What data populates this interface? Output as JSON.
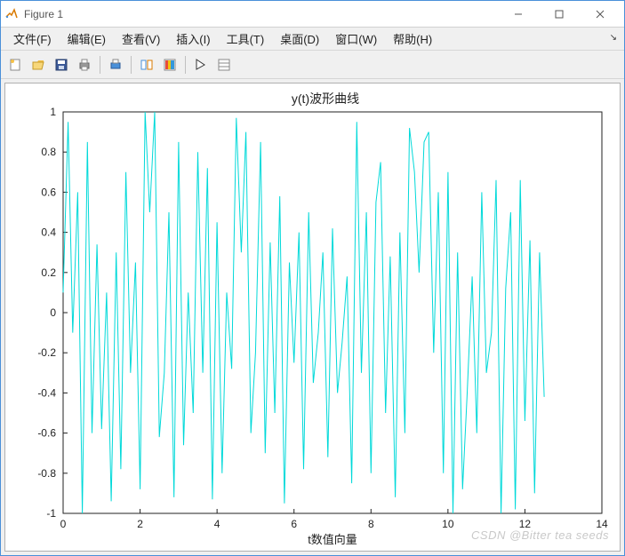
{
  "window": {
    "title": "Figure 1"
  },
  "menu": {
    "file": "文件(F)",
    "edit": "编辑(E)",
    "view": "查看(V)",
    "insert": "插入(I)",
    "tools": "工具(T)",
    "desktop": "桌面(D)",
    "window": "窗口(W)",
    "help": "帮助(H)"
  },
  "toolbar_icons": {
    "new": "new-figure-icon",
    "open": "open-icon",
    "save": "save-icon",
    "print": "print-icon",
    "print_preview": "print-preview-icon",
    "link": "link-icon",
    "colorbar": "colorbar-icon",
    "pointer": "pointer-icon",
    "datacursor": "data-cursor-icon"
  },
  "watermark": "CSDN @Bitter tea seeds",
  "chart_data": {
    "type": "line",
    "title": "y(t)波形曲线",
    "xlabel": "t数值向量",
    "ylabel": "",
    "xlim": [
      0,
      14
    ],
    "ylim": [
      -1,
      1
    ],
    "x_ticks": [
      0,
      2,
      4,
      6,
      8,
      10,
      12,
      14
    ],
    "y_ticks": [
      -1,
      -0.8,
      -0.6,
      -0.4,
      -0.2,
      0,
      0.2,
      0.4,
      0.6,
      0.8,
      1
    ],
    "line_color": "#00d9d9",
    "x": [
      0.0,
      0.13,
      0.25,
      0.38,
      0.5,
      0.63,
      0.75,
      0.88,
      1.0,
      1.13,
      1.25,
      1.38,
      1.5,
      1.63,
      1.75,
      1.88,
      2.0,
      2.13,
      2.25,
      2.38,
      2.5,
      2.63,
      2.75,
      2.88,
      3.0,
      3.13,
      3.25,
      3.38,
      3.5,
      3.63,
      3.75,
      3.88,
      4.0,
      4.13,
      4.25,
      4.38,
      4.5,
      4.63,
      4.75,
      4.88,
      5.0,
      5.13,
      5.25,
      5.38,
      5.5,
      5.63,
      5.75,
      5.88,
      6.0,
      6.13,
      6.25,
      6.38,
      6.5,
      6.63,
      6.75,
      6.88,
      7.0,
      7.13,
      7.25,
      7.38,
      7.5,
      7.63,
      7.75,
      7.88,
      8.0,
      8.13,
      8.25,
      8.38,
      8.5,
      8.63,
      8.75,
      8.88,
      9.0,
      9.13,
      9.25,
      9.38,
      9.5,
      9.63,
      9.75,
      9.88,
      10.0,
      10.13,
      10.25,
      10.38,
      10.5,
      10.63,
      10.75,
      10.88,
      11.0,
      11.13,
      11.25,
      11.38,
      11.5,
      11.63,
      11.75,
      11.88,
      12.0,
      12.13,
      12.25,
      12.38,
      12.5
    ],
    "y": [
      0.1,
      0.95,
      -0.1,
      0.6,
      -1.0,
      0.85,
      -0.6,
      0.34,
      -0.58,
      0.1,
      -0.94,
      0.3,
      -0.78,
      0.7,
      -0.3,
      0.25,
      -0.88,
      1.0,
      0.5,
      1.0,
      -0.62,
      -0.3,
      0.5,
      -0.92,
      0.85,
      -0.66,
      0.1,
      -0.5,
      0.8,
      -0.3,
      0.72,
      -0.93,
      0.45,
      -0.8,
      0.1,
      -0.28,
      0.97,
      0.3,
      0.9,
      -0.6,
      -0.2,
      0.85,
      -0.7,
      0.35,
      -0.5,
      0.58,
      -0.95,
      0.25,
      -0.25,
      0.4,
      -0.78,
      0.5,
      -0.35,
      -0.1,
      0.3,
      -0.72,
      0.42,
      -0.4,
      -0.15,
      0.18,
      -0.85,
      0.95,
      -0.3,
      0.5,
      -0.8,
      0.55,
      0.75,
      -0.5,
      0.28,
      -0.92,
      0.4,
      -0.6,
      0.92,
      0.7,
      0.2,
      0.85,
      0.9,
      -0.2,
      0.6,
      -0.8,
      0.7,
      -1.0,
      0.3,
      -0.88,
      -0.4,
      0.18,
      -0.6,
      0.6,
      -0.3,
      -0.1,
      0.66,
      -1.0,
      0.12,
      0.5,
      -0.98,
      0.66,
      -0.54,
      0.36,
      -0.9,
      0.3,
      -0.42
    ]
  }
}
